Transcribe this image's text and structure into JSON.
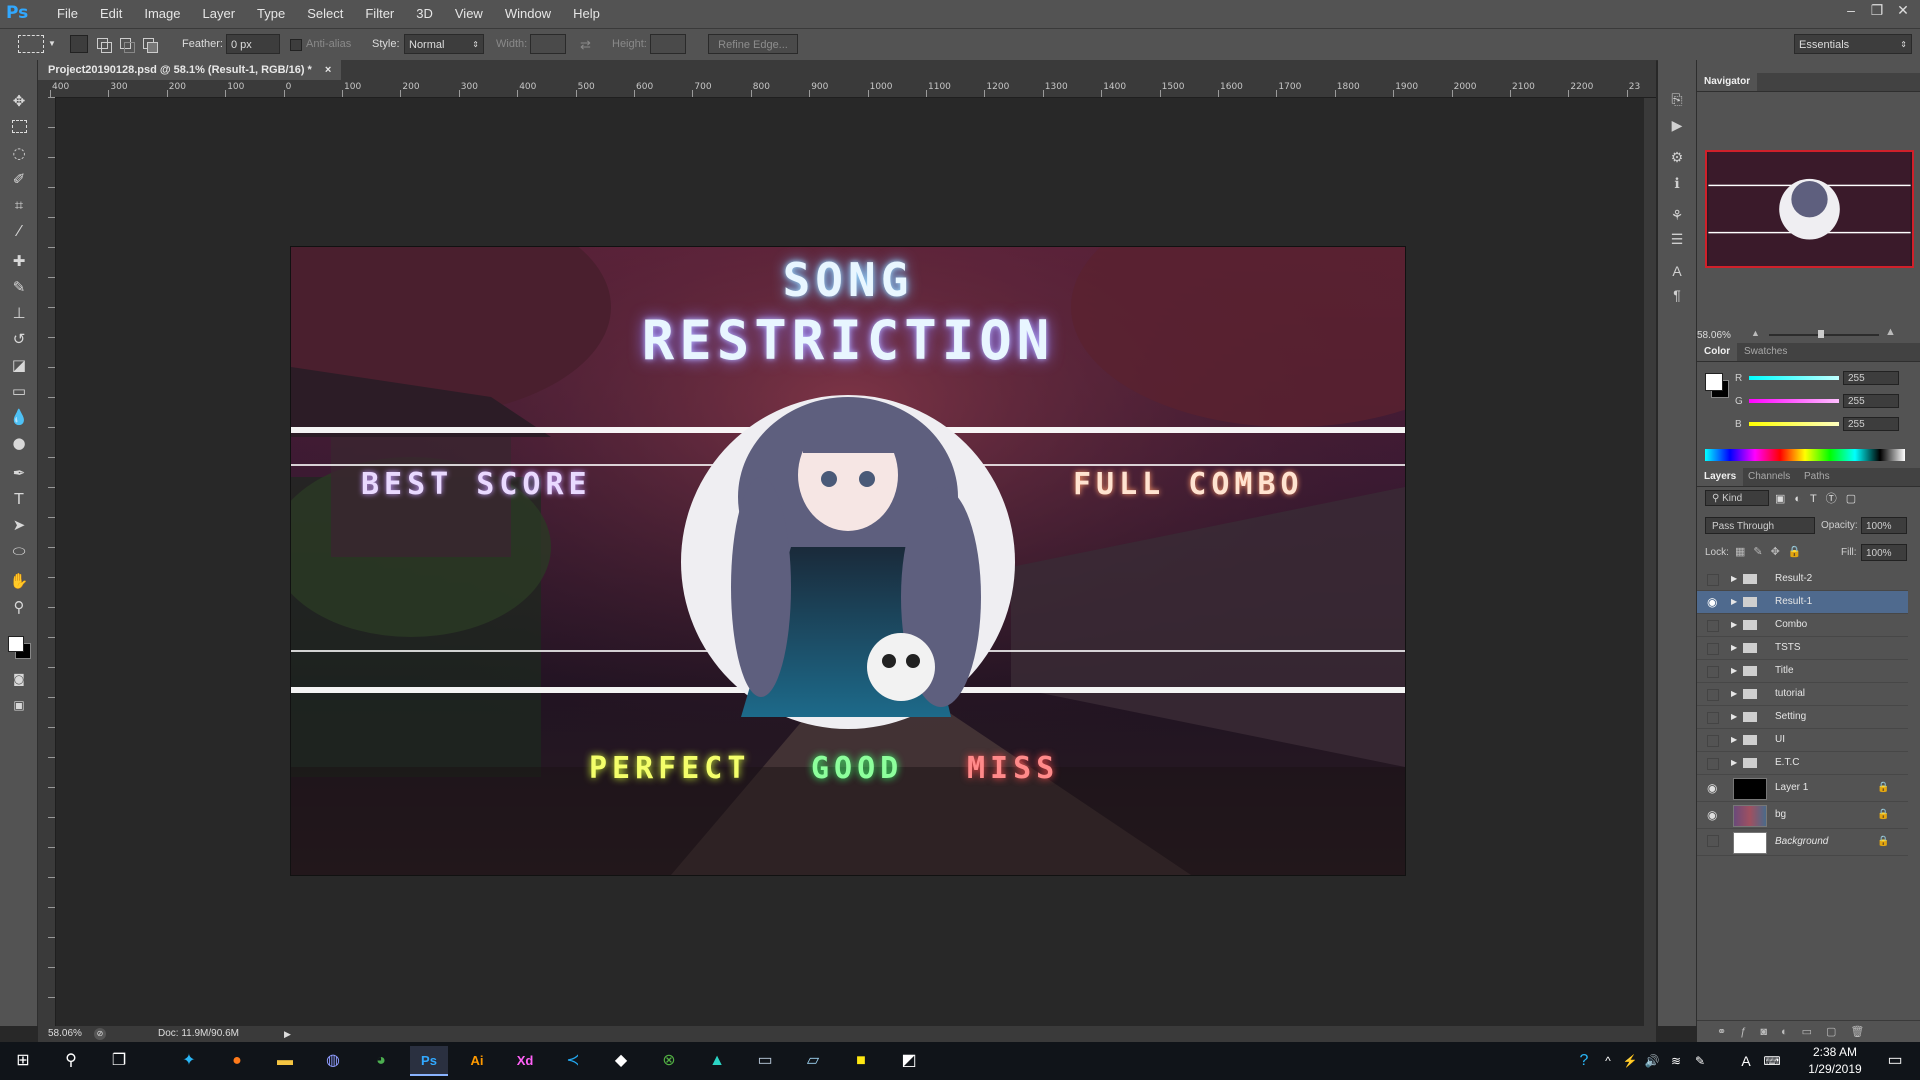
{
  "app": {
    "logo": "Ps"
  },
  "menu": [
    "File",
    "Edit",
    "Image",
    "Layer",
    "Type",
    "Select",
    "Filter",
    "3D",
    "View",
    "Window",
    "Help"
  ],
  "window_controls": {
    "minimize": "–",
    "restore": "❐",
    "close": "✕"
  },
  "options": {
    "feather_label": "Feather:",
    "feather_value": "0 px",
    "antialias_label": "Anti-alias",
    "style_label": "Style:",
    "style_value": "Normal",
    "width_label": "Width:",
    "height_label": "Height:",
    "refine_edge": "Refine Edge...",
    "workspace": "Essentials"
  },
  "document": {
    "tab_title": "Project20190128.psd @ 58.1% (Result-1, RGB/16) *",
    "close_glyph": "×",
    "ruler_ticks": [
      "400",
      "300",
      "200",
      "100",
      "0",
      "100",
      "200",
      "300",
      "400",
      "500",
      "600",
      "700",
      "800",
      "900",
      "1000",
      "1100",
      "1200",
      "1300",
      "1400",
      "1500",
      "1600",
      "1700",
      "1800",
      "1900",
      "2000",
      "2100",
      "2200",
      "23"
    ],
    "zoom": "58.06%",
    "doc_size": "Doc: 11.9M/90.6M"
  },
  "artwork": {
    "title_line1": "SONG",
    "title_line2": "RESTRICTION",
    "best_score": "BEST SCORE",
    "full_combo": "FULL COMBO",
    "perfect": "PERFECT",
    "good": "GOOD",
    "miss": "MISS",
    "colors": {
      "perfect": "#f4ff6a",
      "good": "#8dff9c",
      "miss": "#ff8a8a",
      "title": "#e8f6ff"
    }
  },
  "navigator": {
    "tab": "Navigator",
    "zoom": "58.06%"
  },
  "color_panel": {
    "tabs": [
      "Color",
      "Swatches"
    ],
    "channels": [
      {
        "label": "R",
        "value": "255",
        "color": "#4ad6d6"
      },
      {
        "label": "G",
        "value": "255",
        "color": "#e05be0"
      },
      {
        "label": "B",
        "value": "255",
        "color": "#e6e63a"
      }
    ]
  },
  "layers_panel": {
    "tabs": [
      "Layers",
      "Channels",
      "Paths"
    ],
    "kind": "Kind",
    "blend_mode": "Pass Through",
    "opacity_label": "Opacity:",
    "opacity": "100%",
    "lock_label": "Lock:",
    "fill_label": "Fill:",
    "fill": "100%",
    "layers": [
      {
        "name": "Result-2",
        "type": "group",
        "visible": false,
        "selected": false
      },
      {
        "name": "Result-1",
        "type": "group",
        "visible": true,
        "selected": true
      },
      {
        "name": "Combo",
        "type": "group",
        "visible": false,
        "selected": false
      },
      {
        "name": "TSTS",
        "type": "group",
        "visible": false,
        "selected": false
      },
      {
        "name": "Title",
        "type": "group",
        "visible": false,
        "selected": false
      },
      {
        "name": "tutorial",
        "type": "group",
        "visible": false,
        "selected": false
      },
      {
        "name": "Setting",
        "type": "group",
        "visible": false,
        "selected": false
      },
      {
        "name": "UI",
        "type": "group",
        "visible": false,
        "selected": false
      },
      {
        "name": "E.T.C",
        "type": "group",
        "visible": false,
        "selected": false
      },
      {
        "name": "Layer 1",
        "type": "layer",
        "visible": true,
        "selected": false,
        "thumb": "#000000"
      },
      {
        "name": "bg",
        "type": "layer",
        "visible": true,
        "selected": false,
        "thumb": "#6a4a7a"
      },
      {
        "name": "Background",
        "type": "layer",
        "visible": false,
        "selected": false,
        "thumb": "#ffffff"
      }
    ]
  },
  "taskbar": {
    "time": "2:38 AM",
    "date": "1/29/2019",
    "apps": [
      "Twitter",
      "Firefox",
      "File Explorer",
      "Discord",
      "Chrome",
      "Photoshop",
      "Illustrator",
      "Adobe XD",
      "VS Code",
      "Unity",
      "Xbox",
      "Unity Hub",
      "Connect",
      "Notepad",
      "KakaoTalk",
      "Photos"
    ],
    "tray": [
      "?",
      "^",
      "⚡",
      "🔊",
      "≋",
      "✎",
      "A"
    ]
  }
}
